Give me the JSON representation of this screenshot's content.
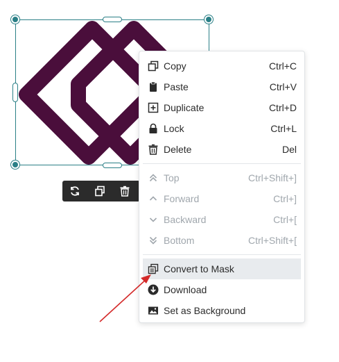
{
  "canvas": {
    "shape_color": "#4a0e3b",
    "selection_color": "#2a7f86"
  },
  "toolbar": {
    "buttons": [
      {
        "name": "replace-button",
        "icon": "refresh-icon"
      },
      {
        "name": "duplicate-button",
        "icon": "copy-icon"
      },
      {
        "name": "delete-button",
        "icon": "trash-icon"
      }
    ]
  },
  "menu": {
    "items": [
      {
        "label": "Copy",
        "shortcut": "Ctrl+C",
        "icon": "copy-icon",
        "disabled": false
      },
      {
        "label": "Paste",
        "shortcut": "Ctrl+V",
        "icon": "clipboard-icon",
        "disabled": false
      },
      {
        "label": "Duplicate",
        "shortcut": "Ctrl+D",
        "icon": "plus-square-icon",
        "disabled": false
      },
      {
        "label": "Lock",
        "shortcut": "Ctrl+L",
        "icon": "lock-icon",
        "disabled": false
      },
      {
        "label": "Delete",
        "shortcut": "Del",
        "icon": "trash-icon",
        "disabled": false
      },
      {
        "label": "Top",
        "shortcut": "Ctrl+Shift+]",
        "icon": "double-chevron-up-icon",
        "disabled": true
      },
      {
        "label": "Forward",
        "shortcut": "Ctrl+]",
        "icon": "chevron-up-icon",
        "disabled": true
      },
      {
        "label": "Backward",
        "shortcut": "Ctrl+[",
        "icon": "chevron-down-icon",
        "disabled": true
      },
      {
        "label": "Bottom",
        "shortcut": "Ctrl+Shift+[",
        "icon": "double-chevron-down-icon",
        "disabled": true
      },
      {
        "label": "Convert to Mask",
        "shortcut": "",
        "icon": "mask-icon",
        "disabled": false,
        "highlighted": true
      },
      {
        "label": "Download",
        "shortcut": "",
        "icon": "download-icon",
        "disabled": false
      },
      {
        "label": "Set as Background",
        "shortcut": "",
        "icon": "image-icon",
        "disabled": false
      }
    ]
  },
  "annotation": {
    "arrow_color": "#d42a2a"
  }
}
